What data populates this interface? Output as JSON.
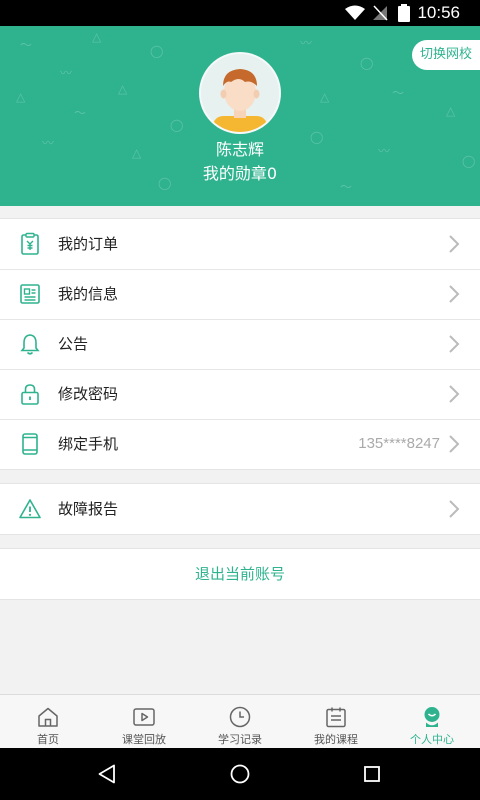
{
  "status_bar": {
    "time": "10:56"
  },
  "header": {
    "switch_label": "切换网校",
    "user_name": "陈志辉",
    "badge_text": "我的勋章0"
  },
  "menu": {
    "items": [
      {
        "label": "我的订单",
        "icon": "order-icon"
      },
      {
        "label": "我的信息",
        "icon": "info-icon"
      },
      {
        "label": "公告",
        "icon": "bell-icon"
      },
      {
        "label": "修改密码",
        "icon": "lock-icon"
      },
      {
        "label": "绑定手机",
        "value": "135****8247",
        "icon": "phone-icon"
      }
    ],
    "report": {
      "label": "故障报告",
      "icon": "warning-icon"
    }
  },
  "logout_label": "退出当前账号",
  "tabs": [
    {
      "label": "首页",
      "icon": "home-icon"
    },
    {
      "label": "课堂回放",
      "icon": "playback-icon"
    },
    {
      "label": "学习记录",
      "icon": "clock-icon"
    },
    {
      "label": "我的课程",
      "icon": "calendar-icon"
    },
    {
      "label": "个人中心",
      "icon": "person-icon",
      "active": true
    }
  ],
  "colors": {
    "primary": "#2fb38f",
    "background": "#f2f2f2"
  }
}
